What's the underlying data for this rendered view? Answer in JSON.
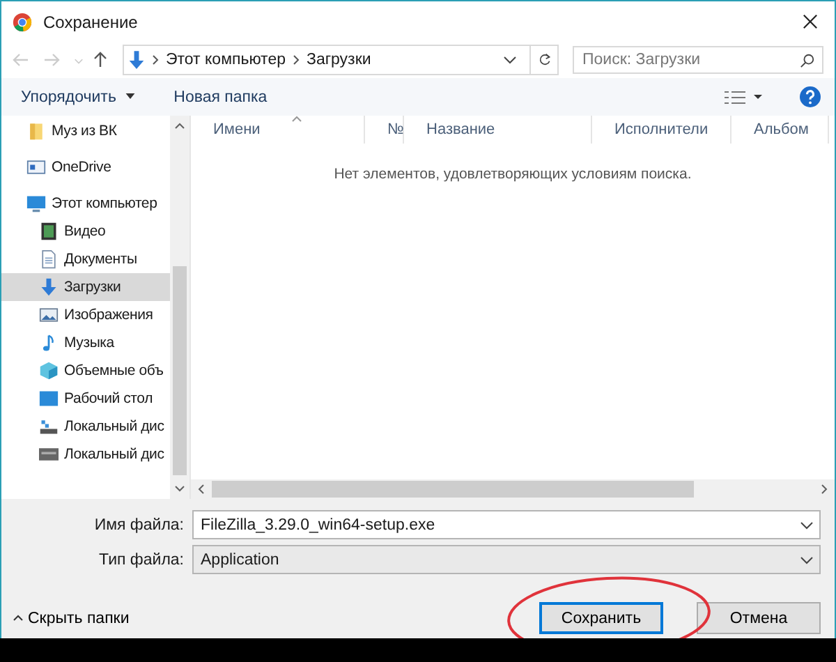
{
  "window": {
    "title": "Сохранение"
  },
  "navigation": {
    "path": [
      "Этот компьютер",
      "Загрузки"
    ],
    "search": {
      "placeholder": "Поиск: Загрузки"
    }
  },
  "toolbar": {
    "organize": "Упорядочить",
    "new_folder": "Новая папка"
  },
  "sidebar": {
    "items": [
      {
        "label": "Муз из ВК",
        "kind": "folder",
        "selected": false
      },
      {
        "label": "OneDrive",
        "kind": "cloud",
        "selected": false
      },
      {
        "label": "Этот компьютер",
        "kind": "computer",
        "selected": false,
        "children": [
          {
            "label": "Видео",
            "kind": "video",
            "selected": false
          },
          {
            "label": "Документы",
            "kind": "documents",
            "selected": false
          },
          {
            "label": "Загрузки",
            "kind": "downloads",
            "selected": true
          },
          {
            "label": "Изображения",
            "kind": "pictures",
            "selected": false
          },
          {
            "label": "Музыка",
            "kind": "music",
            "selected": false
          },
          {
            "label": "Объемные объ",
            "kind": "objects",
            "selected": false
          },
          {
            "label": "Рабочий стол",
            "kind": "desktop",
            "selected": false
          },
          {
            "label": "Локальный дис",
            "kind": "system-drive",
            "selected": false
          },
          {
            "label": "Локальный дис",
            "kind": "drive",
            "selected": false
          }
        ]
      }
    ]
  },
  "table": {
    "columns": [
      "Имени",
      "№",
      "Название",
      "Исполнители",
      "Альбом"
    ],
    "empty_message": "Нет элементов, удовлетворяющих условиям поиска."
  },
  "file_name": {
    "label": "Имя файла:",
    "value": "FileZilla_3.29.0_win64-setup.exe"
  },
  "file_type": {
    "label": "Тип файла:",
    "value": "Application"
  },
  "hide_folders": "Скрыть папки",
  "buttons": [
    {
      "label": "Сохранить",
      "kind": "default"
    },
    {
      "label": "Отмена",
      "kind": "normal"
    }
  ]
}
